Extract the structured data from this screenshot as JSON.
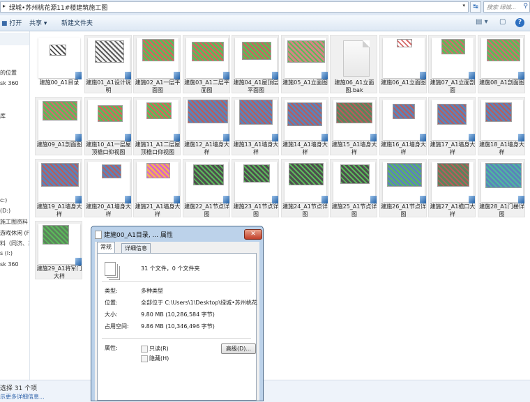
{
  "address_bar": {
    "path": "绿城•苏州桃花源11#楼建筑施工图",
    "search_placeholder": "搜索 绿城...",
    "icons": {
      "expand": "chevron-right-icon",
      "dropdown": "chevron-down-icon",
      "refresh": "refresh-icon",
      "search": "search-icon"
    }
  },
  "toolbar": {
    "open_label": "打开",
    "share_label": "共享 ▾",
    "new_folder_label": "新建文件夹",
    "view_icon": "view-options-icon",
    "preview_icon": "preview-pane-icon",
    "help_icon": "help-icon"
  },
  "nav_pane": {
    "items": [
      {
        "label": "的位置"
      },
      {
        "label": "sk 360"
      },
      {
        "label": "库"
      },
      {
        "label": "c:)"
      },
      {
        "label": "(D:)"
      },
      {
        "label": "施工图资料 (I"
      },
      {
        "label": "游戏休闲 (F:)"
      },
      {
        "label": "料（同济、三"
      },
      {
        "label": "s (I:)"
      },
      {
        "label": "sk 360"
      }
    ]
  },
  "files": [
    {
      "name": "建施00_A1目录",
      "type": "dwg"
    },
    {
      "name": "建施01_A1设计说明",
      "type": "dwg"
    },
    {
      "name": "建施02_A1一层平面图",
      "type": "dwg"
    },
    {
      "name": "建施03_A1二层平面图",
      "type": "dwg"
    },
    {
      "name": "建施04_A1屋顶层平面图",
      "type": "dwg"
    },
    {
      "name": "建施05_A1立面图",
      "type": "dwg"
    },
    {
      "name": "建施06_A1立面图.bak",
      "type": "bak"
    },
    {
      "name": "建施06_A1立面图",
      "type": "dwg"
    },
    {
      "name": "建施07_A1立面剖面",
      "type": "dwg"
    },
    {
      "name": "建施08_A1剖面图",
      "type": "dwg"
    },
    {
      "name": "建施09_A1剖面图",
      "type": "dwg"
    },
    {
      "name": "建施10_A1一层屋顶檐口仰视图",
      "type": "dwg"
    },
    {
      "name": "建施11_A1二层屋顶檐口仰视图",
      "type": "dwg"
    },
    {
      "name": "建施12_A1墙身大样",
      "type": "dwg"
    },
    {
      "name": "建施13_A1墙身大样",
      "type": "dwg"
    },
    {
      "name": "建施14_A1墙身大样",
      "type": "dwg"
    },
    {
      "name": "建施15_A1墙身大样",
      "type": "dwg"
    },
    {
      "name": "建施16_A1墙身大样",
      "type": "dwg"
    },
    {
      "name": "建施17_A1墙身大样",
      "type": "dwg"
    },
    {
      "name": "建施18_A1墙身大样",
      "type": "dwg"
    },
    {
      "name": "建施19_A1墙身大样",
      "type": "dwg"
    },
    {
      "name": "建施20_A1墙身大样",
      "type": "dwg"
    },
    {
      "name": "建施21_A1墙身大样",
      "type": "dwg"
    },
    {
      "name": "建施22_A1节点详图",
      "type": "dwg"
    },
    {
      "name": "建施23_A1节点详图",
      "type": "dwg"
    },
    {
      "name": "建施24_A1节点详图",
      "type": "dwg"
    },
    {
      "name": "建施25_A1节点详图",
      "type": "dwg"
    },
    {
      "name": "建施26_A1节点详图",
      "type": "dwg"
    },
    {
      "name": "建施27_A1檐口大样",
      "type": "dwg"
    },
    {
      "name": "建施28_A1门楼详图",
      "type": "dwg"
    },
    {
      "name": "建施29_A1将军门大样",
      "type": "dwg"
    }
  ],
  "status_bar": {
    "selected": "选择 31 个项",
    "details_link": "示更多详细信息..."
  },
  "dialog": {
    "title": "建施00_A1目录, ... 属性",
    "close_icon": "close-icon",
    "tabs": [
      {
        "label": "常规",
        "active": true
      },
      {
        "label": "详细信息",
        "active": false
      }
    ],
    "summary": "31 个文件，0 个文件夹",
    "rows": [
      {
        "label": "类型:",
        "value": "多种类型"
      },
      {
        "label": "位置:",
        "value": "全部位于 C:\\Users\\1\\Desktop\\绿城•苏州桃花"
      },
      {
        "label": "大小:",
        "value": "9.80 MB (10,286,584 字节)"
      },
      {
        "label": "占用空间:",
        "value": "9.86 MB (10,346,496 字节)"
      }
    ],
    "attributes_label": "属性:",
    "readonly_label": "只读(R)",
    "readonly_checked": false,
    "hidden_label": "隐藏(H)",
    "hidden_checked": false,
    "advanced_button": "高级(D)..."
  }
}
